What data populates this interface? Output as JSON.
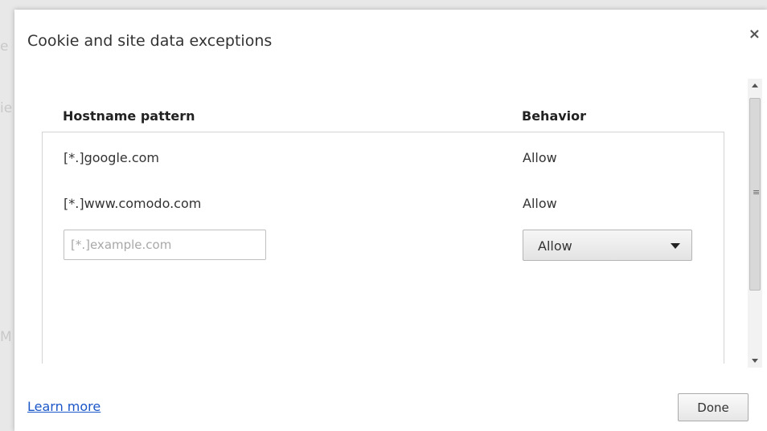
{
  "background": {
    "fragments": [
      "e",
      "ie",
      "M"
    ]
  },
  "dialog": {
    "title": "Cookie and site data exceptions",
    "close_glyph": "×",
    "columns": {
      "hostname": "Hostname pattern",
      "behavior": "Behavior"
    },
    "rows": [
      {
        "host": "[*.]google.com",
        "behavior": "Allow"
      },
      {
        "host": "[*.]www.comodo.com",
        "behavior": "Allow"
      }
    ],
    "new_entry": {
      "placeholder": "[*.]example.com",
      "value": "",
      "behavior_selected": "Allow"
    },
    "scrollbar": {
      "grip_glyph": "≡"
    },
    "footer": {
      "learn_more": "Learn more",
      "done": "Done"
    }
  },
  "colors": {
    "link": "#1a56c8",
    "border": "#d4d4d4"
  }
}
